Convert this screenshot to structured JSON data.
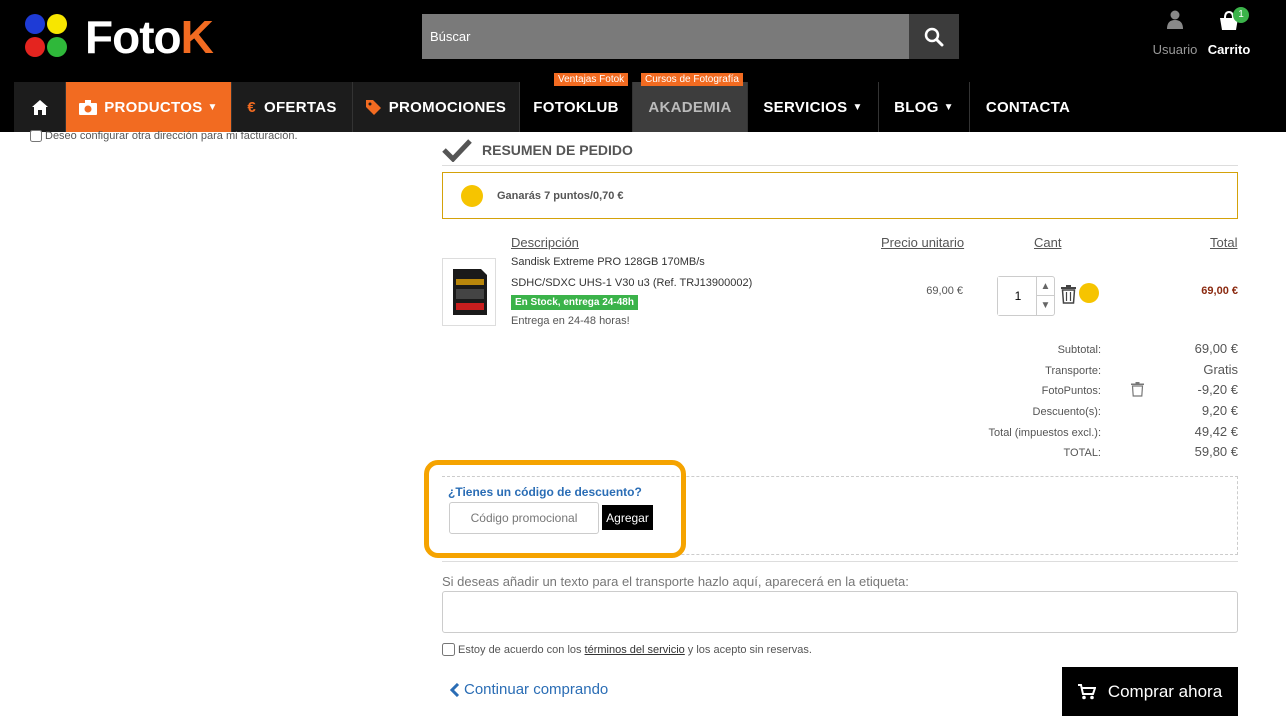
{
  "logo": {
    "text_main": "Foto",
    "text_k": "K",
    "dot_colors": [
      "#1e3bd6",
      "#f7e600",
      "#e4241f",
      "#2fb83a"
    ]
  },
  "search": {
    "placeholder": "Búscar"
  },
  "header": {
    "user_label": "Usuario",
    "cart_label": "Carrito",
    "cart_count": "1"
  },
  "nav": {
    "home_icon": "home-icon",
    "items": [
      {
        "label": "PRODUCTOS",
        "icon": "camera-icon",
        "has_dropdown": true
      },
      {
        "label": "OFERTAS",
        "icon": "euro-icon"
      },
      {
        "label": "PROMOCIONES",
        "icon": "tag-icon"
      },
      {
        "label": "FOTOKLUB",
        "tag": "Ventajas Fotok"
      },
      {
        "label": "AKADEMIA",
        "tag": "Cursos de Fotografía"
      },
      {
        "label": "SERVICIOS",
        "has_dropdown": true
      },
      {
        "label": "BLOG",
        "has_dropdown": true
      },
      {
        "label": "CONTACTA"
      }
    ],
    "colors": {
      "productos_bg": "#f26b21",
      "akademia_bg": "#3d3d3d",
      "bar_bg": "#1c1c1c"
    }
  },
  "billing": {
    "checkbox_label": "Deseo configurar otra dirección para mi facturación."
  },
  "summary": {
    "title": "RESUMEN DE PEDIDO",
    "points_text": "Ganarás 7 puntos/0,70 €",
    "columns": {
      "description": "Descripción",
      "unit_price": "Precio unitario",
      "qty": "Cant",
      "total": "Total"
    },
    "product": {
      "name": "Sandisk Extreme PRO 128GB 170MB/s SDHC/SDXC UHS-1 V30 u3 (Ref. TRJ13900002)",
      "stock": "En Stock, entrega 24-48h",
      "delivery": "Entrega en 24-48 horas!",
      "unit_price": "69,00 €",
      "qty": "1",
      "total": "69,00 €"
    },
    "totals": [
      {
        "label": "Subtotal:",
        "value": "69,00 €"
      },
      {
        "label": "Transporte:",
        "value": "Gratis"
      },
      {
        "label": "FotoPuntos:",
        "value": "-9,20 €"
      },
      {
        "label": "Descuento(s):",
        "value": "9,20 €"
      },
      {
        "label": "Total (impuestos excl.):",
        "value": "49,42 €"
      },
      {
        "label": "TOTAL:",
        "value": "59,80 €"
      }
    ]
  },
  "coupon": {
    "question": "¿Tienes un código de descuento?",
    "placeholder": "Código promocional",
    "button": "Agregar"
  },
  "shipping": {
    "label": "Si deseas añadir un texto para el transporte hazlo aquí, aparecerá en la etiqueta:"
  },
  "terms": {
    "prefix": "Estoy de acuerdo con los",
    "link": "términos del servicio",
    "suffix": "y los acepto sin reservas."
  },
  "actions": {
    "continue": "Continuar comprando",
    "buy": "Comprar ahora"
  }
}
